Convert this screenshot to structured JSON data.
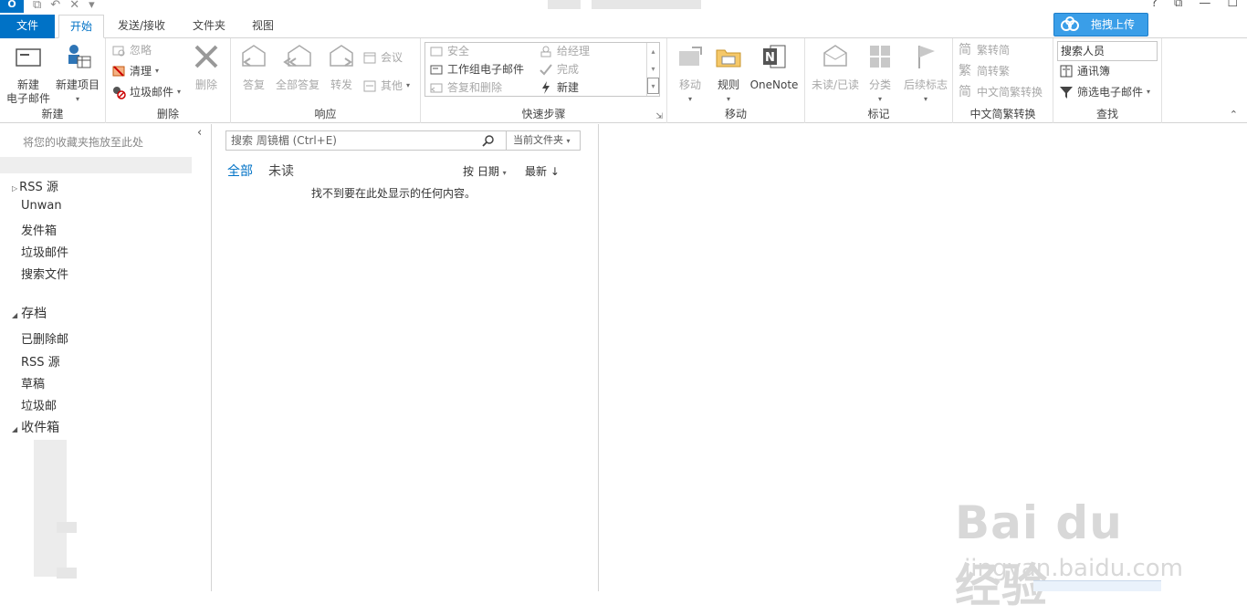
{
  "titlebar": {
    "app_icon_text": "O",
    "win_help": "?",
    "win_restore": "⧉",
    "win_minimize": "—",
    "win_maximize": "☐"
  },
  "tabs": {
    "file": "文件",
    "home": "开始",
    "send_receive": "发送/接收",
    "folder": "文件夹",
    "view": "视图",
    "upload_button": "拖拽上传"
  },
  "ribbon": {
    "new_group": {
      "new_email_line1": "新建",
      "new_email_line2": "电子邮件",
      "new_items": "新建项目",
      "label": "新建"
    },
    "delete_group": {
      "ignore": "忽略",
      "cleanup": "清理",
      "junk": "垃圾邮件",
      "delete": "删除",
      "label": "删除"
    },
    "respond_group": {
      "reply": "答复",
      "reply_all": "全部答复",
      "forward": "转发",
      "meeting": "会议",
      "more": "其他",
      "label": "响应"
    },
    "quick_steps_group": {
      "item1": "安全",
      "item2": "给经理",
      "item3": "工作组电子邮件",
      "item4": "完成",
      "item5": "答复和删除",
      "item6": "新建",
      "label": "快速步骤"
    },
    "move_group": {
      "move": "移动",
      "rules": "规则",
      "onenote": "OneNote",
      "label": "移动"
    },
    "tags_group": {
      "unread_read": "未读/已读",
      "categorize": "分类",
      "followup": "后续标志",
      "label": "标记"
    },
    "chinese_group": {
      "to_simplified": "繁转简",
      "to_traditional": "简转繁",
      "convert": "中文简繁转换",
      "label": "中文简繁转换"
    },
    "find_group": {
      "search_people": "搜索人员",
      "address_book": "通讯簿",
      "filter_email": "筛选电子邮件",
      "label": "查找"
    }
  },
  "left_pane": {
    "drop_hint": "将您的收藏夹拖放至此处",
    "folders_top": [
      "RSS 源",
      "Unwan",
      "发件箱",
      "垃圾邮件",
      "搜索文件"
    ],
    "section_archive": "存档",
    "archive_folders": [
      "已删除邮",
      "RSS 源",
      "草稿",
      "垃圾邮"
    ],
    "section_inbox": "收件箱"
  },
  "mid_pane": {
    "search_placeholder": "搜索 周镜楣 (Ctrl+E)",
    "scope": "当前文件夹",
    "filter_all": "全部",
    "filter_unread": "未读",
    "sort_by": "按 日期",
    "sort_order": "最新 ↓",
    "empty_message": "找不到要在此处显示的任何内容。"
  },
  "watermark": {
    "brand": "Bai du 经验",
    "url": "jingyan.baidu.com"
  },
  "colors": {
    "accent": "#0072c6",
    "upload_bg": "#3a9ee8"
  }
}
